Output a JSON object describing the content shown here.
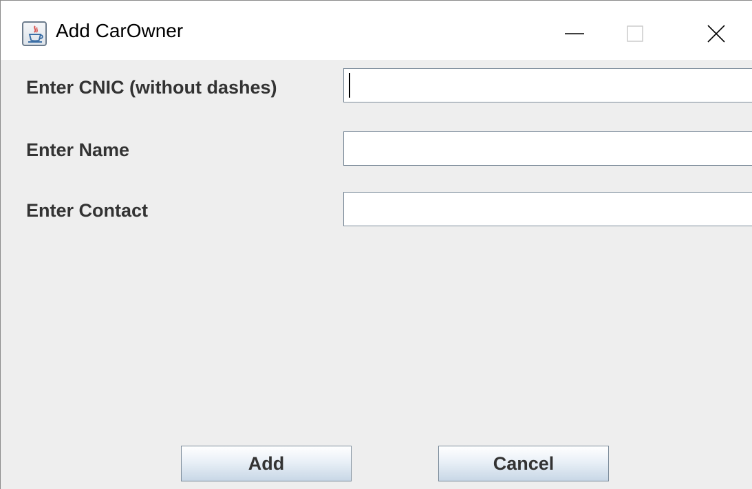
{
  "window": {
    "title": "Add CarOwner",
    "icon": "java-cup-icon",
    "controls": [
      "minimize-icon",
      "maximize-icon",
      "close-icon"
    ]
  },
  "form": {
    "cnic": {
      "label": "Enter CNIC (without dashes)",
      "value": "",
      "placeholder": ""
    },
    "name": {
      "label": "Enter Name",
      "value": "",
      "placeholder": ""
    },
    "contact": {
      "label": "Enter Contact",
      "value": "",
      "placeholder": ""
    }
  },
  "buttons": {
    "add_label": "Add",
    "cancel_label": "Cancel"
  },
  "colors": {
    "background": "#eeeeee",
    "titlebar": "#ffffff",
    "label_text": "#333333",
    "field_border": "#7a8a99",
    "button_gradient_top": "#ffffff",
    "button_gradient_bottom": "#c8d7e6"
  }
}
